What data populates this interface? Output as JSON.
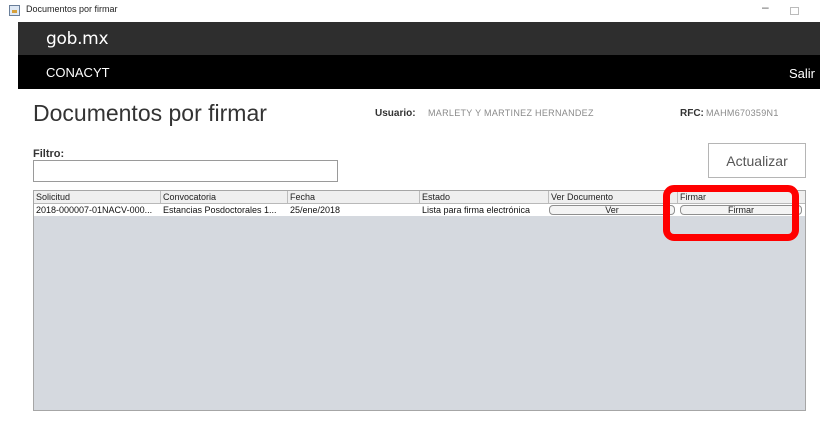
{
  "window": {
    "title": "Documentos por firmar",
    "minimize": "–"
  },
  "header": {
    "logo": "gob.mx",
    "org": "CONACYT",
    "logout": "Salir"
  },
  "page": {
    "title": "Documentos por firmar",
    "usuario_label": "Usuario:",
    "usuario_value": "MARLETY Y MARTINEZ HERNANDEZ",
    "rfc_label": "RFC:",
    "rfc_value": "MAHM670359N1"
  },
  "filter": {
    "label": "Filtro:",
    "value": "",
    "refresh_label": "Actualizar"
  },
  "table": {
    "columns": [
      "Solicitud",
      "Convocatoria",
      "Fecha",
      "Estado",
      "Ver Documento",
      "Firmar"
    ],
    "rows": [
      {
        "solicitud": "2018-000007-01NACV-000...",
        "convocatoria": "Estancias Posdoctorales 1...",
        "fecha": "25/ene/2018",
        "estado": "Lista para firma electrónica",
        "ver_label": "Ver",
        "firmar_label": "Firmar"
      }
    ]
  },
  "colors": {
    "gob_bar": "#2e2e2e",
    "conacyt_bar": "#000000",
    "table_bg": "#d5d9df",
    "highlight": "#ff0000"
  },
  "icons": {
    "app": "java-window-icon"
  }
}
